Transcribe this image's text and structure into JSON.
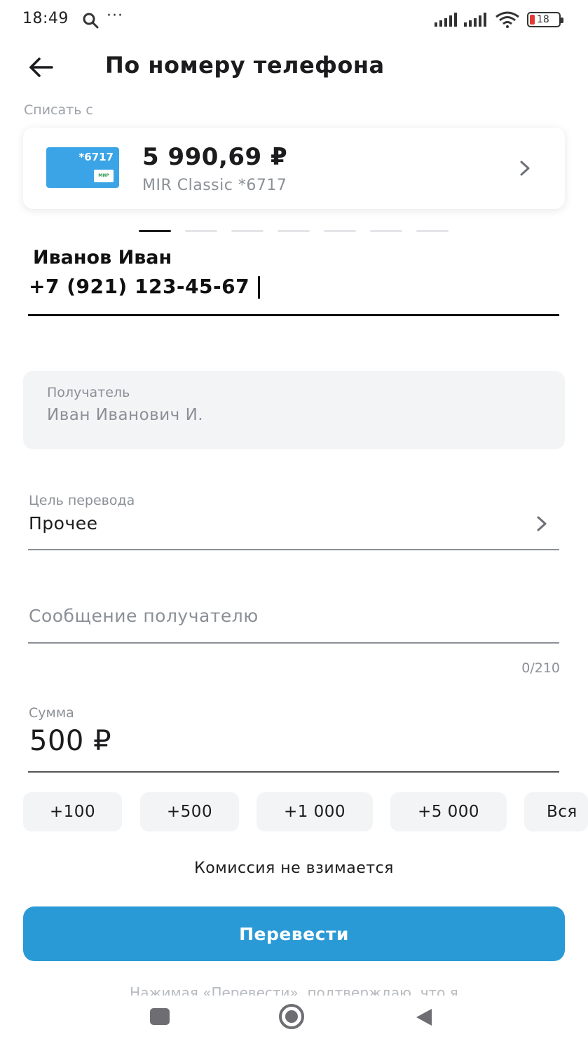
{
  "status_bar": {
    "time": "18:49",
    "dots": "···",
    "battery": "18",
    "icons": [
      "search-icon",
      "signal-icon",
      "signal-icon",
      "wifi-icon",
      "battery-icon"
    ]
  },
  "header": {
    "title": "По номеру телефона",
    "back_icon": "arrow-left-icon"
  },
  "debit": {
    "label": "Списать с",
    "card_number": "*6717",
    "card_logo_text": "МИР",
    "balance": "5 990,69 ₽",
    "card_name": "MIR Classic *6717",
    "chevron_icon": "chevron-right-icon"
  },
  "pager": {
    "count": 7,
    "active_index": 0
  },
  "phone": {
    "contact_name": "Иванов Иван",
    "number": "+7 (921) 123-45-67"
  },
  "recipient": {
    "label": "Получатель",
    "value": "Иван Иванович И."
  },
  "purpose": {
    "label": "Цель перевода",
    "value": "Прочее"
  },
  "message": {
    "placeholder": "Сообщение получателю",
    "counter": "0/210"
  },
  "amount": {
    "label": "Сумма",
    "value": "500 ₽"
  },
  "quick_amounts": [
    "+100",
    "+500",
    "+1 000",
    "+5 000",
    "Вся"
  ],
  "commission_text": "Комиссия не взимается",
  "transfer_button": "Перевести",
  "disclaimer": "Нажимая «Перевести», подтверждаю, что я",
  "colors": {
    "primary": "#2a9ad6",
    "card": "#3ba4e6",
    "muted": "#8b9096",
    "field_bg": "#f3f4f6"
  }
}
